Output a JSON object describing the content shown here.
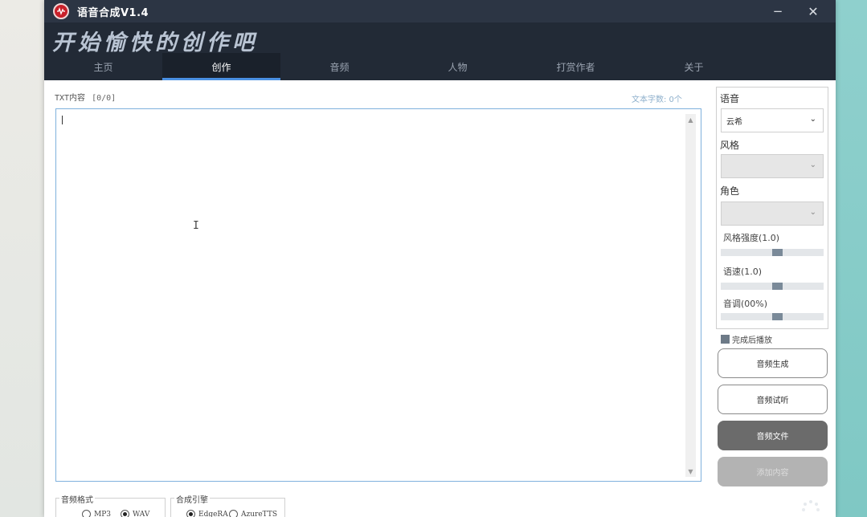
{
  "window": {
    "title": "语音合成V1.4",
    "minimize": "−",
    "close": "✕"
  },
  "header": {
    "slogan": "开始愉快的创作吧",
    "tabs": [
      "主页",
      "创作",
      "音频",
      "人物",
      "打赏作者",
      "关于"
    ],
    "active_tab": "创作"
  },
  "editor": {
    "label": "TXT内容",
    "counter": "[0/0]",
    "word_count": "文本字数: 0个",
    "text": ""
  },
  "format_group": {
    "legend": "音频格式",
    "options": [
      "MP3",
      "WAV"
    ],
    "selected": "WAV"
  },
  "engine_group": {
    "legend": "合成引擎",
    "options": [
      "EdgeRA",
      "AzureTTS"
    ],
    "selected": "EdgeRA"
  },
  "side_panel": {
    "voice_label": "语音",
    "voice_value": "云希",
    "style_label": "风格",
    "style_value": "",
    "role_label": "角色",
    "role_value": "",
    "style_degree_label": "风格强度(1.0)",
    "style_degree": 0.55,
    "rate_label": "语速(1.0)",
    "rate": 0.55,
    "pitch_label": "音调(00%)",
    "pitch": 0.55
  },
  "autoplay": {
    "label": "完成后播放",
    "checked": true
  },
  "buttons": {
    "generate": "音频生成",
    "preview": "音频试听",
    "file": "音频文件",
    "add_content": "添加内容"
  },
  "colors": {
    "titlebar": "#2c3544",
    "header": "#222a36",
    "tab_active_underline": "#4a90e2",
    "dark_button": "#6b6b6b"
  }
}
